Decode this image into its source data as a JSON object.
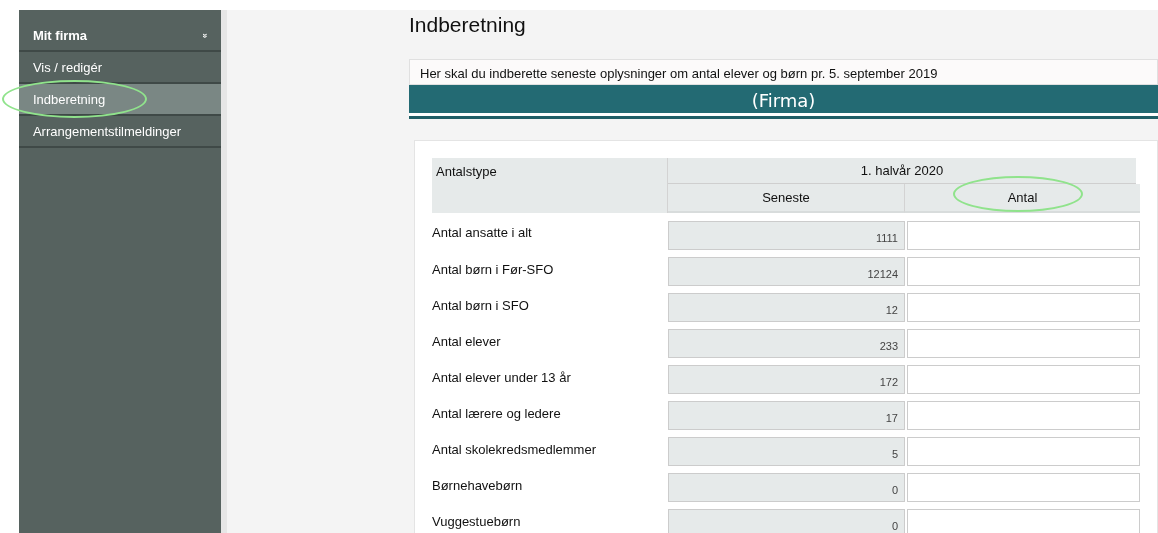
{
  "sidebar": {
    "heading": "Mit firma",
    "heading_icon": "»",
    "items": [
      {
        "label": "Vis / redigér",
        "selected": false,
        "circled": false
      },
      {
        "label": "Indberetning",
        "selected": true,
        "circled": true
      },
      {
        "label": "Arrangementstilmeldinger",
        "selected": false,
        "circled": false
      }
    ]
  },
  "page_title": "Indberetning",
  "notice": "Her skal du indberette seneste oplysninger om antal elever og børn pr. 5. september 2019",
  "banner": "(Firma)",
  "table": {
    "type_header": "Antalstype",
    "period_header": "1. halvår 2020",
    "columns": [
      {
        "label": "Seneste",
        "circled": false
      },
      {
        "label": "Antal",
        "circled": true
      }
    ],
    "rows": [
      {
        "label": "Antal ansatte i alt",
        "latest": "1111"
      },
      {
        "label": "Antal børn i Før-SFO",
        "latest": "12124"
      },
      {
        "label": "Antal børn i SFO",
        "latest": "12"
      },
      {
        "label": "Antal elever",
        "latest": "233"
      },
      {
        "label": "Antal elever under 13 år",
        "latest": "172"
      },
      {
        "label": "Antal lærere og ledere",
        "latest": "17"
      },
      {
        "label": "Antal skolekredsmedlemmer",
        "latest": "5"
      },
      {
        "label": "Børnehavebørn",
        "latest": "0"
      },
      {
        "label": "Vuggestuebørn",
        "latest": "0"
      }
    ]
  }
}
